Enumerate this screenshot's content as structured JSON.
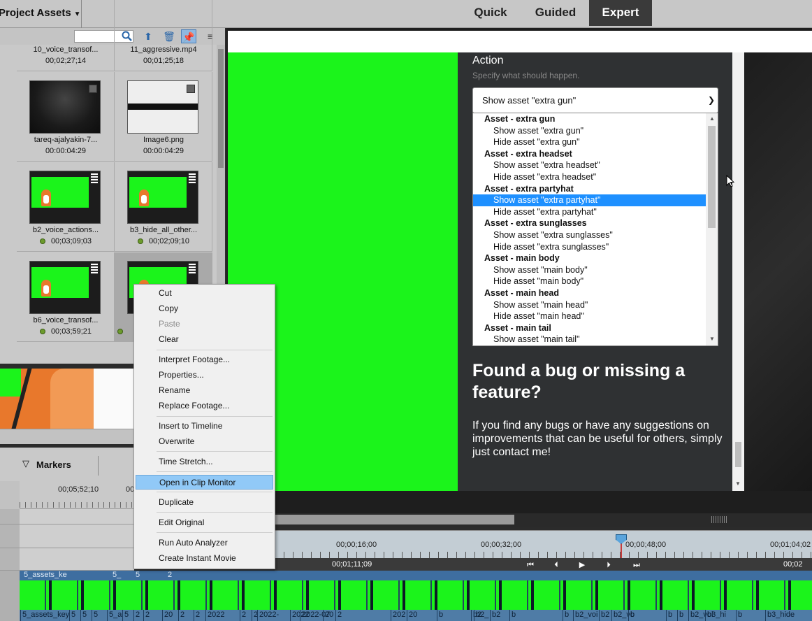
{
  "topbar": {
    "project_title": "Project Assets",
    "tabs": [
      "Quick",
      "Guided",
      "Expert"
    ],
    "active_tab": "Expert"
  },
  "assets": {
    "search_placeholder": "",
    "items": [
      {
        "name": "10_voice_transof...",
        "duration": "00;02;27;14"
      },
      {
        "name": "11_aggressive.mp4",
        "duration": "00;01;25;18"
      },
      {
        "name": "tareq-ajalyakin-7...",
        "duration": "00:00:04:29"
      },
      {
        "name": "Image6.png",
        "duration": "00:00:04:29"
      },
      {
        "name": "b2_voice_actions...",
        "duration": "00;03;09;03"
      },
      {
        "name": "b3_hide_all_other...",
        "duration": "00;02;09;10"
      },
      {
        "name": "b6_voice_transof...",
        "duration": "00;03;59;21"
      }
    ]
  },
  "markers": {
    "label": "Markers"
  },
  "left_timeline": {
    "time1": "00;05;52;10",
    "time2": "00"
  },
  "web": {
    "action_title": "Action",
    "action_subtitle": "Specify what should happen.",
    "selected_value": "Show asset \"extra gun\"",
    "options": [
      {
        "type": "group",
        "label": "Asset - extra gun"
      },
      {
        "type": "item",
        "label": "Show asset \"extra gun\""
      },
      {
        "type": "item",
        "label": "Hide asset \"extra gun\""
      },
      {
        "type": "group",
        "label": "Asset - extra headset"
      },
      {
        "type": "item",
        "label": "Show asset \"extra headset\""
      },
      {
        "type": "item",
        "label": "Hide asset \"extra headset\""
      },
      {
        "type": "group",
        "label": "Asset - extra partyhat"
      },
      {
        "type": "item",
        "label": "Show asset \"extra partyhat\"",
        "selected": true
      },
      {
        "type": "item",
        "label": "Hide asset \"extra partyhat\""
      },
      {
        "type": "group",
        "label": "Asset - extra sunglasses"
      },
      {
        "type": "item",
        "label": "Show asset \"extra sunglasses\""
      },
      {
        "type": "item",
        "label": "Hide asset \"extra sunglasses\""
      },
      {
        "type": "group",
        "label": "Asset - main body"
      },
      {
        "type": "item",
        "label": "Show asset \"main body\""
      },
      {
        "type": "item",
        "label": "Hide asset \"main body\""
      },
      {
        "type": "group",
        "label": "Asset - main head"
      },
      {
        "type": "item",
        "label": "Show asset \"main head\""
      },
      {
        "type": "item",
        "label": "Hide asset \"main head\""
      },
      {
        "type": "group",
        "label": "Asset - main tail"
      },
      {
        "type": "item",
        "label": "Show asset \"main tail\""
      }
    ],
    "bug_heading": "Found a bug or missing a feature?",
    "bug_text": "If you find any bugs or have any suggestions on improvements that can be useful for others, simply just contact me!"
  },
  "timeline": {
    "ruler": [
      "00;00;16;00",
      "00;00;32;00",
      "00;00;48;00",
      "00;01;04;02"
    ],
    "current_time": "00;01;11;09",
    "end_time": "00;02",
    "top_labels": [
      "5_assets_ke",
      "5_",
      "5",
      "2"
    ],
    "bottom_labels": [
      "5_assets_key",
      "5",
      "5",
      "5",
      "5_a",
      "5",
      "2",
      "2",
      "20",
      "2",
      "2",
      "2022",
      "2",
      "2",
      "2022-",
      "2022",
      "2022-07",
      "20",
      "2",
      "202",
      "20",
      "b",
      "b2",
      "b2_",
      "b2",
      "b",
      "b",
      "b2_voi",
      "b2",
      "b2_vo",
      "b",
      "b",
      "b",
      "b2_voi",
      "b3_hi",
      "b",
      "b3_hide"
    ]
  },
  "context_menu": {
    "items": [
      {
        "label": "Cut"
      },
      {
        "label": "Copy"
      },
      {
        "label": "Paste",
        "disabled": true
      },
      {
        "label": "Clear"
      },
      {
        "label": "Interpret Footage..."
      },
      {
        "label": "Properties..."
      },
      {
        "label": "Rename"
      },
      {
        "label": "Replace Footage..."
      },
      {
        "label": "Insert to Timeline"
      },
      {
        "label": "Overwrite"
      },
      {
        "label": "Time Stretch..."
      },
      {
        "label": "Open in Clip Monitor",
        "highlighted": true
      },
      {
        "label": "Duplicate"
      },
      {
        "label": "Edit Original"
      },
      {
        "label": "Run Auto Analyzer"
      },
      {
        "label": "Create Instant Movie"
      }
    ]
  },
  "colors": {
    "accent": "#1e90ff",
    "menu_highlight": "#91c9f7",
    "greenscreen": "#1bf41b",
    "expert_tab": "#3a3a3a"
  }
}
